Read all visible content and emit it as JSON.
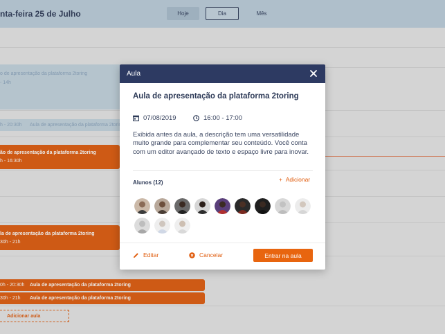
{
  "header": {
    "date_title": "nta-feira 25 de Julho",
    "view_tabs": [
      "Hoje",
      "Dia",
      "Mês"
    ]
  },
  "background_events": [
    {
      "title": "o de apresentação da plataforma 2toring",
      "time": "- 14h"
    },
    {
      "time": "h - 20:30h",
      "title": "Aula de apresentação da plataforma 2toring"
    },
    {
      "title": "ão de apresentação da plataforma 2toring",
      "time": "h - 16:30h"
    },
    {
      "title": "la de apresentação da plataforma 2toring",
      "time": "30h - 21h"
    },
    {
      "time": "0h - 20:30h",
      "title": "Aula de apresentação da plataforma 2toring"
    },
    {
      "time": "30h - 21h",
      "title": "Aula de apresentação da plataforma 2toring"
    }
  ],
  "add_class_label": "Adicionar aula",
  "modal": {
    "header_title": "Aula",
    "lesson_title": "Aula de apresentação da plataforma 2toring",
    "date": "07/08/2019",
    "time": "16:00 - 17:00",
    "description": "Exibida antes da aula, a descrição tem uma versatilidade muito grande para complementar seu conteúdo. Você conta com um editor avançado de texto e espaço livre para inovar.",
    "students_label": "Alunos (12)",
    "add_label": "Adicionar",
    "edit_label": "Editar",
    "cancel_label": "Cancelar",
    "enter_label": "Entrar na aula"
  },
  "colors": {
    "accent": "#e05c0d",
    "header_bg": "#2d3a62",
    "topbar_bg": "#bccedc"
  }
}
